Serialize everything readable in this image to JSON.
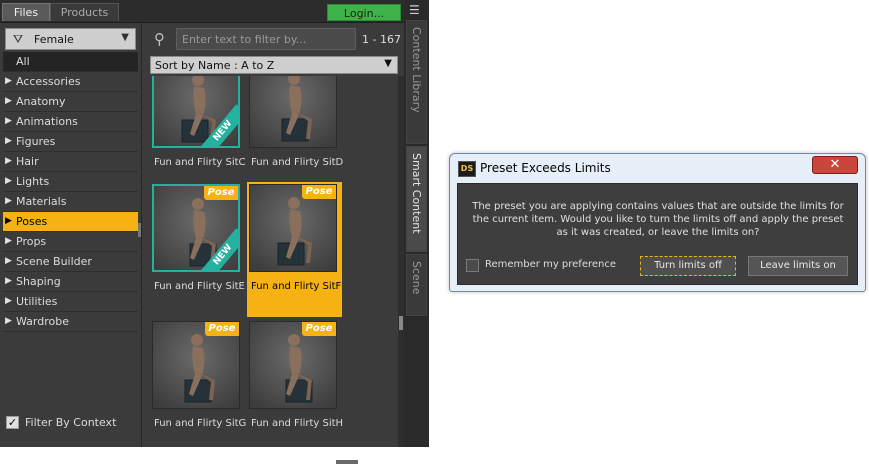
{
  "panel": {
    "tabs": [
      "Files",
      "Products"
    ],
    "login_label": "Login...",
    "filter_dropdown": "Female",
    "categories": [
      {
        "label": "All",
        "arrow": ""
      },
      {
        "label": "Accessories",
        "arrow": "▶"
      },
      {
        "label": "Anatomy",
        "arrow": "▶"
      },
      {
        "label": "Animations",
        "arrow": "▶"
      },
      {
        "label": "Figures",
        "arrow": "▶"
      },
      {
        "label": "Hair",
        "arrow": "▶"
      },
      {
        "label": "Lights",
        "arrow": "▶"
      },
      {
        "label": "Materials",
        "arrow": "▶"
      },
      {
        "label": "Poses",
        "arrow": "▶"
      },
      {
        "label": "Props",
        "arrow": "▶"
      },
      {
        "label": "Scene Builder",
        "arrow": "▶"
      },
      {
        "label": "Shaping",
        "arrow": "▶"
      },
      {
        "label": "Utilities",
        "arrow": "▶"
      },
      {
        "label": "Wardrobe",
        "arrow": "▶"
      }
    ],
    "selected_category": "Poses",
    "filter_by_context_label": "Filter By Context",
    "filter_by_context_checked": true,
    "search_placeholder": "Enter text to filter by...",
    "result_count": "1 - 167",
    "sort_label": "Sort by Name : A to Z",
    "tiles": [
      {
        "name": "Fun and Flirty SitC",
        "pose_badge": "",
        "new_badge": "NEW",
        "teal": true,
        "selected": false
      },
      {
        "name": "Fun and Flirty SitD",
        "pose_badge": "",
        "new_badge": "",
        "teal": false,
        "selected": false
      },
      {
        "name": "Fun and Flirty SitE",
        "pose_badge": "Pose",
        "new_badge": "NEW",
        "teal": true,
        "selected": false
      },
      {
        "name": "Fun and Flirty SitF",
        "pose_badge": "Pose",
        "new_badge": "",
        "teal": false,
        "selected": true
      },
      {
        "name": "Fun and Flirty SitG",
        "pose_badge": "Pose",
        "new_badge": "",
        "teal": false,
        "selected": false
      },
      {
        "name": "Fun and Flirty SitH",
        "pose_badge": "Pose",
        "new_badge": "",
        "teal": false,
        "selected": false
      }
    ],
    "side_tabs": [
      "Content Library",
      "Smart Content",
      "Scene"
    ]
  },
  "dialog": {
    "icon_text": "DS",
    "title": "Preset Exceeds Limits",
    "close_label": "✕",
    "message": "The preset you are applying contains values that are outside the limits for the current item. Would you like to turn the limits off and apply the preset as it was created, or leave the limits on?",
    "remember_label": "Remember my preference",
    "remember_checked": false,
    "turn_off_label": "Turn limits off",
    "leave_on_label": "Leave limits on"
  },
  "colors": {
    "accent": "#f5b212",
    "login_green": "#3fb34a",
    "new_teal": "#25b0a0",
    "close_red": "#c9463d"
  }
}
